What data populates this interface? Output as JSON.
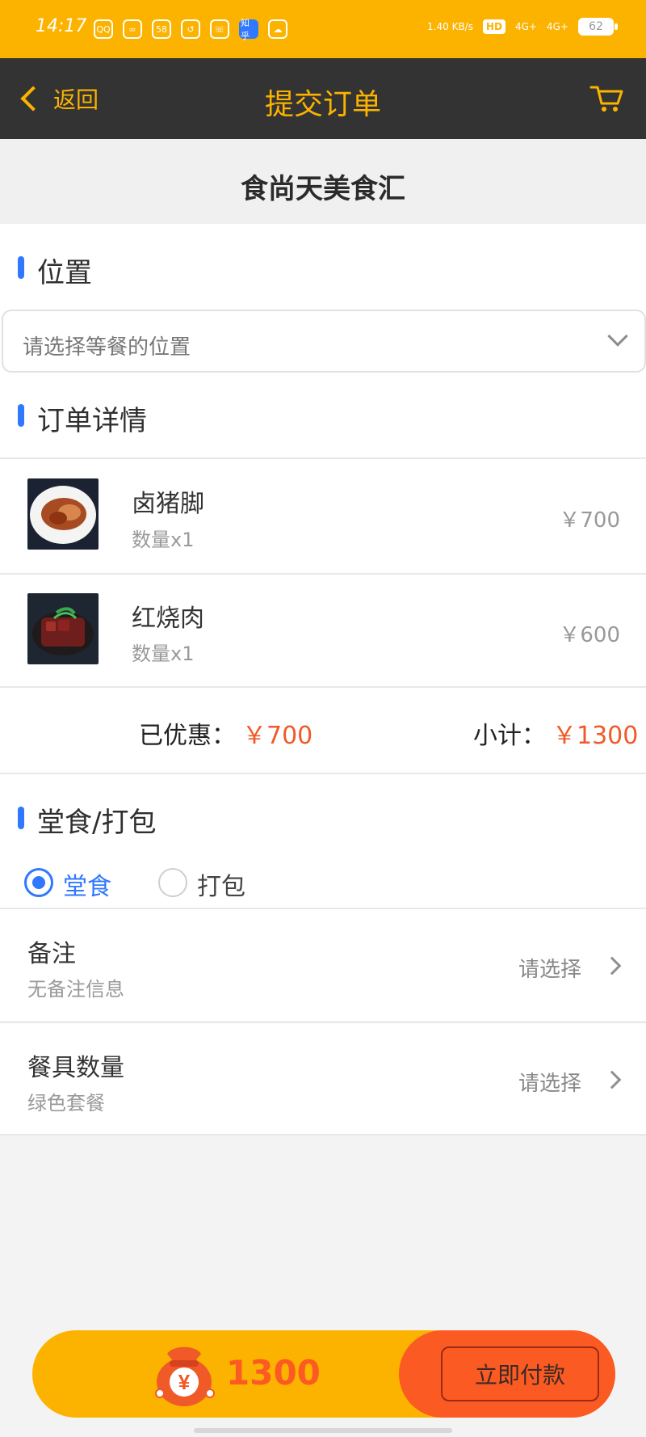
{
  "status_bar": {
    "time": "14:17",
    "apps": [
      "QQ",
      "∞",
      "58",
      "↺",
      "☏",
      "知乎",
      "☁"
    ],
    "network": "1.40 KB/s",
    "hd": "HD",
    "signal1": "4G+",
    "signal2": "4G+",
    "battery": "62"
  },
  "header": {
    "back_label": "返回",
    "title": "提交订单"
  },
  "store": {
    "name": "食尚天美食汇"
  },
  "location_section": {
    "title": "位置",
    "select_placeholder": "请选择等餐的位置"
  },
  "order_section": {
    "title": "订单详情",
    "items": [
      {
        "name": "卤猪脚",
        "qty": "数量x1",
        "price": "￥700"
      },
      {
        "name": "红烧肉",
        "qty": "数量x1",
        "price": "￥600"
      }
    ],
    "discount_label": "已优惠：",
    "discount_value": "￥700",
    "subtotal_label": "小计：",
    "subtotal_value": "￥1300"
  },
  "service_section": {
    "title": "堂食/打包",
    "options": [
      {
        "label": "堂食",
        "checked": true
      },
      {
        "label": "打包",
        "checked": false
      }
    ]
  },
  "remark_row": {
    "title": "备注",
    "subtitle": "无备注信息",
    "action": "请选择"
  },
  "tableware_row": {
    "title": "餐具数量",
    "subtitle": "绿色套餐",
    "action": "请选择"
  },
  "pay_bar": {
    "total": "1300",
    "button_label": "立即付款"
  },
  "colors": {
    "brand_yellow": "#fcb300",
    "header_dark": "#333333",
    "accent_blue": "#2f78ff",
    "price_orange": "#f05a28"
  }
}
